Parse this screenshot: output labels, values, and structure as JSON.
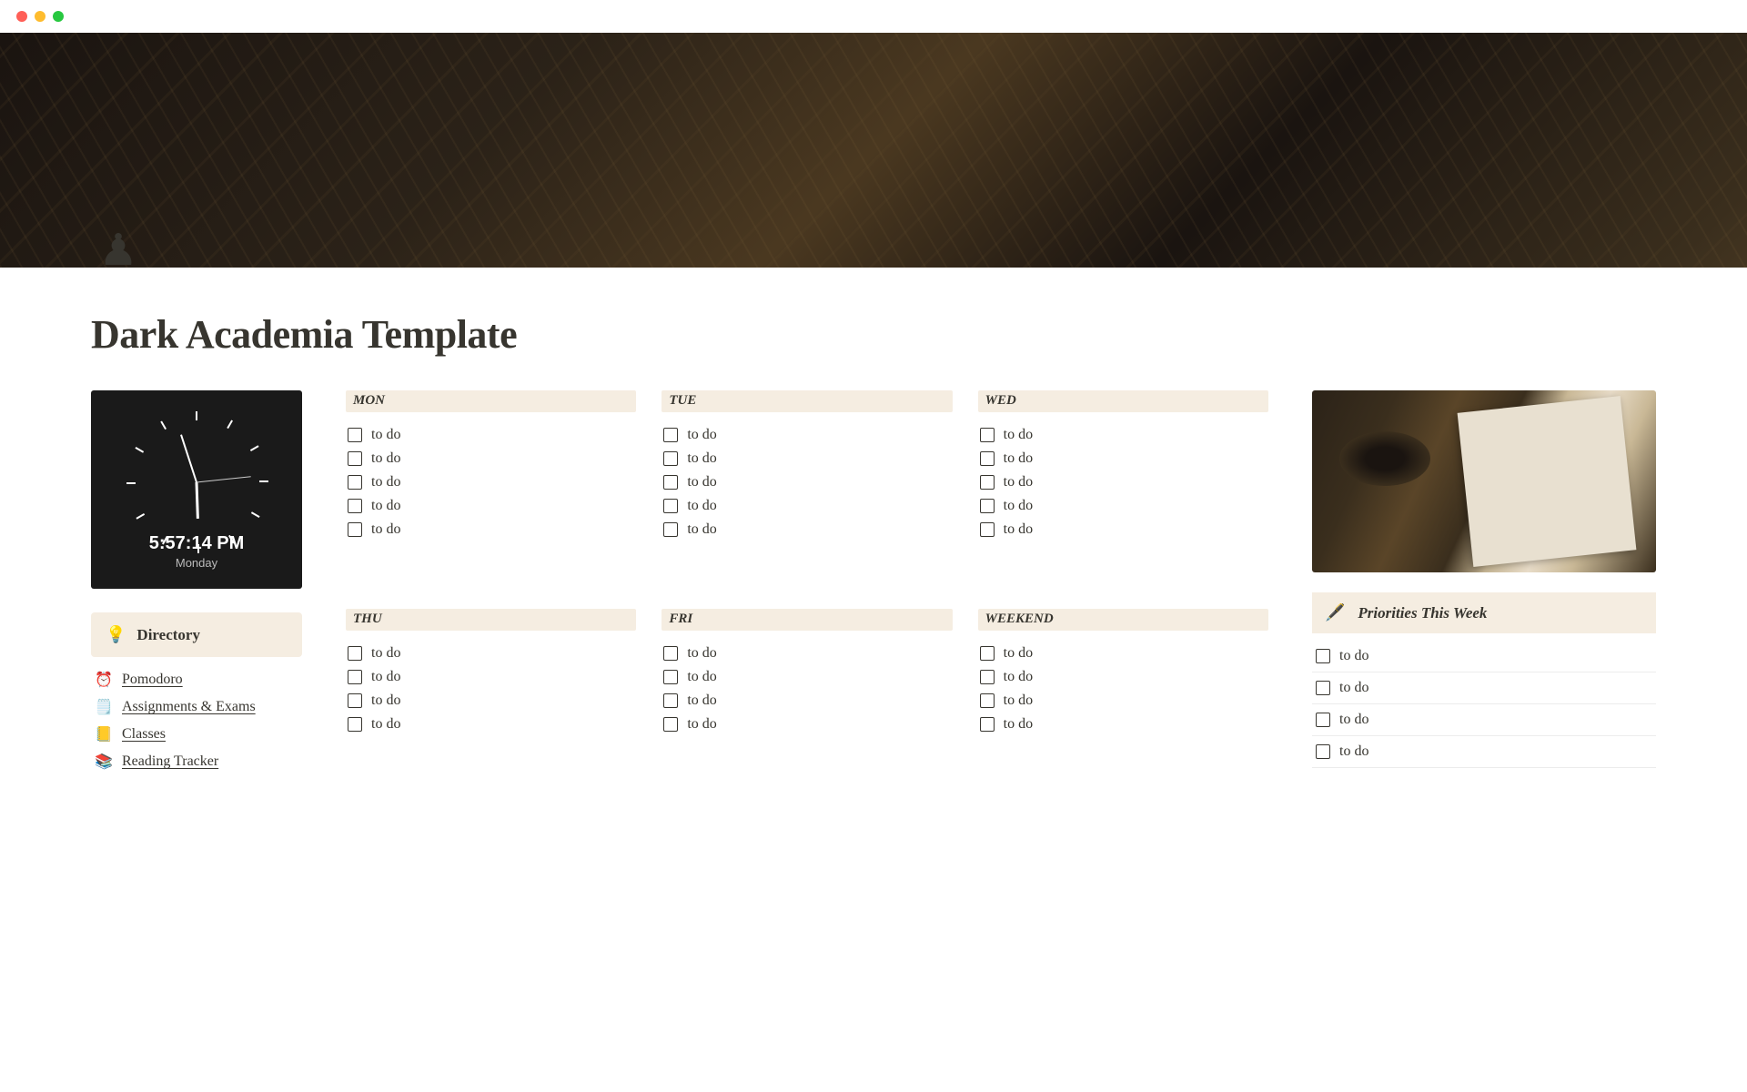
{
  "window": {
    "title": "Dark Academia Template"
  },
  "pageIcon": "♟",
  "pageTitle": "Dark Academia Template",
  "clock": {
    "time": "5:57:14 PM",
    "day": "Monday"
  },
  "directory": {
    "icon": "💡",
    "label": "Directory",
    "items": [
      {
        "emoji": "⏰",
        "label": "Pomodoro"
      },
      {
        "emoji": "🗒️",
        "label": "Assignments & Exams"
      },
      {
        "emoji": "📒",
        "label": "Classes"
      },
      {
        "emoji": "📚",
        "label": "Reading Tracker"
      }
    ]
  },
  "days": [
    {
      "label": "MON",
      "todos": [
        "to do",
        "to do",
        "to do",
        "to do",
        "to do"
      ]
    },
    {
      "label": "TUE",
      "todos": [
        "to do",
        "to do",
        "to do",
        "to do",
        "to do"
      ]
    },
    {
      "label": "WED",
      "todos": [
        "to do",
        "to do",
        "to do",
        "to do",
        "to do"
      ]
    },
    {
      "label": "THU",
      "todos": [
        "to do",
        "to do",
        "to do",
        "to do"
      ]
    },
    {
      "label": "FRI",
      "todos": [
        "to do",
        "to do",
        "to do",
        "to do"
      ]
    },
    {
      "label": "WEEKEND",
      "todos": [
        "to do",
        "to do",
        "to do",
        "to do"
      ]
    }
  ],
  "priorities": {
    "icon": "🖋️",
    "title": "Priorities This Week",
    "items": [
      "to do",
      "to do",
      "to do",
      "to do"
    ]
  }
}
